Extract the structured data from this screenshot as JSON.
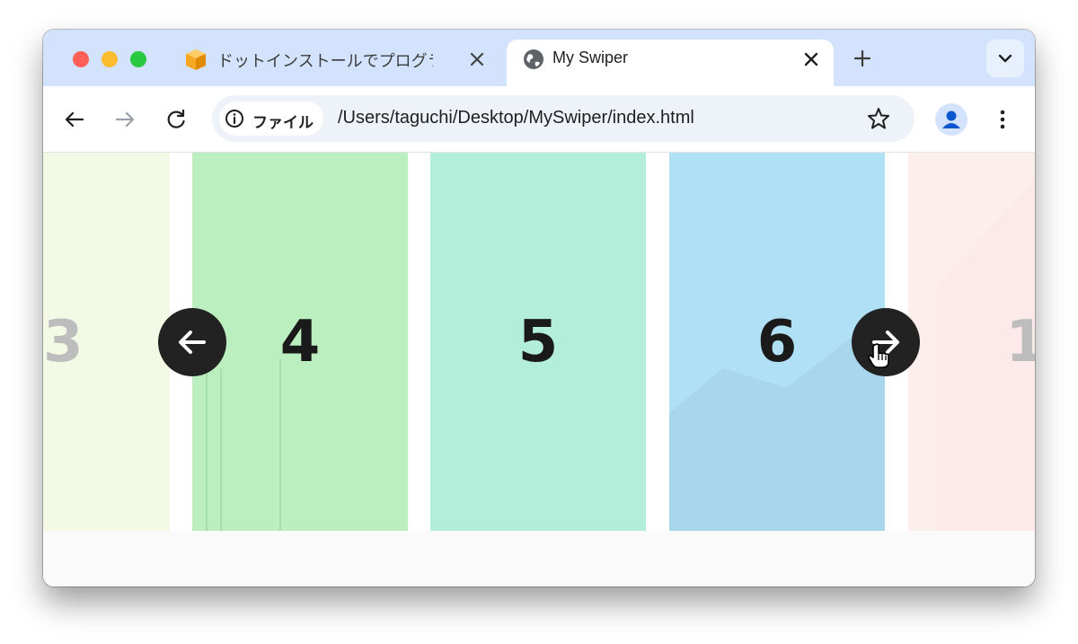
{
  "browser": {
    "tabs": [
      {
        "title": "ドットインストールでプログラミング",
        "icon": "box-favicon-icon",
        "active": false
      },
      {
        "title": "My Swiper",
        "icon": "globe-icon",
        "active": true
      }
    ],
    "address": {
      "chip_label": "ファイル",
      "url": "/Users/taguchi/Desktop/MySwiper/index.html"
    }
  },
  "slider": {
    "slides": [
      {
        "label": "3",
        "color": "#f2fae6",
        "faded": true
      },
      {
        "label": "4",
        "color": "#bcefbf",
        "faded": false
      },
      {
        "label": "5",
        "color": "#b2eed9",
        "faded": false
      },
      {
        "label": "6",
        "color": "#b0e0f5",
        "faded": false
      },
      {
        "label": "1",
        "color": "#fdeeee",
        "faded": true
      }
    ],
    "prev_icon": "arrow-left-icon",
    "next_icon": "arrow-right-icon"
  }
}
